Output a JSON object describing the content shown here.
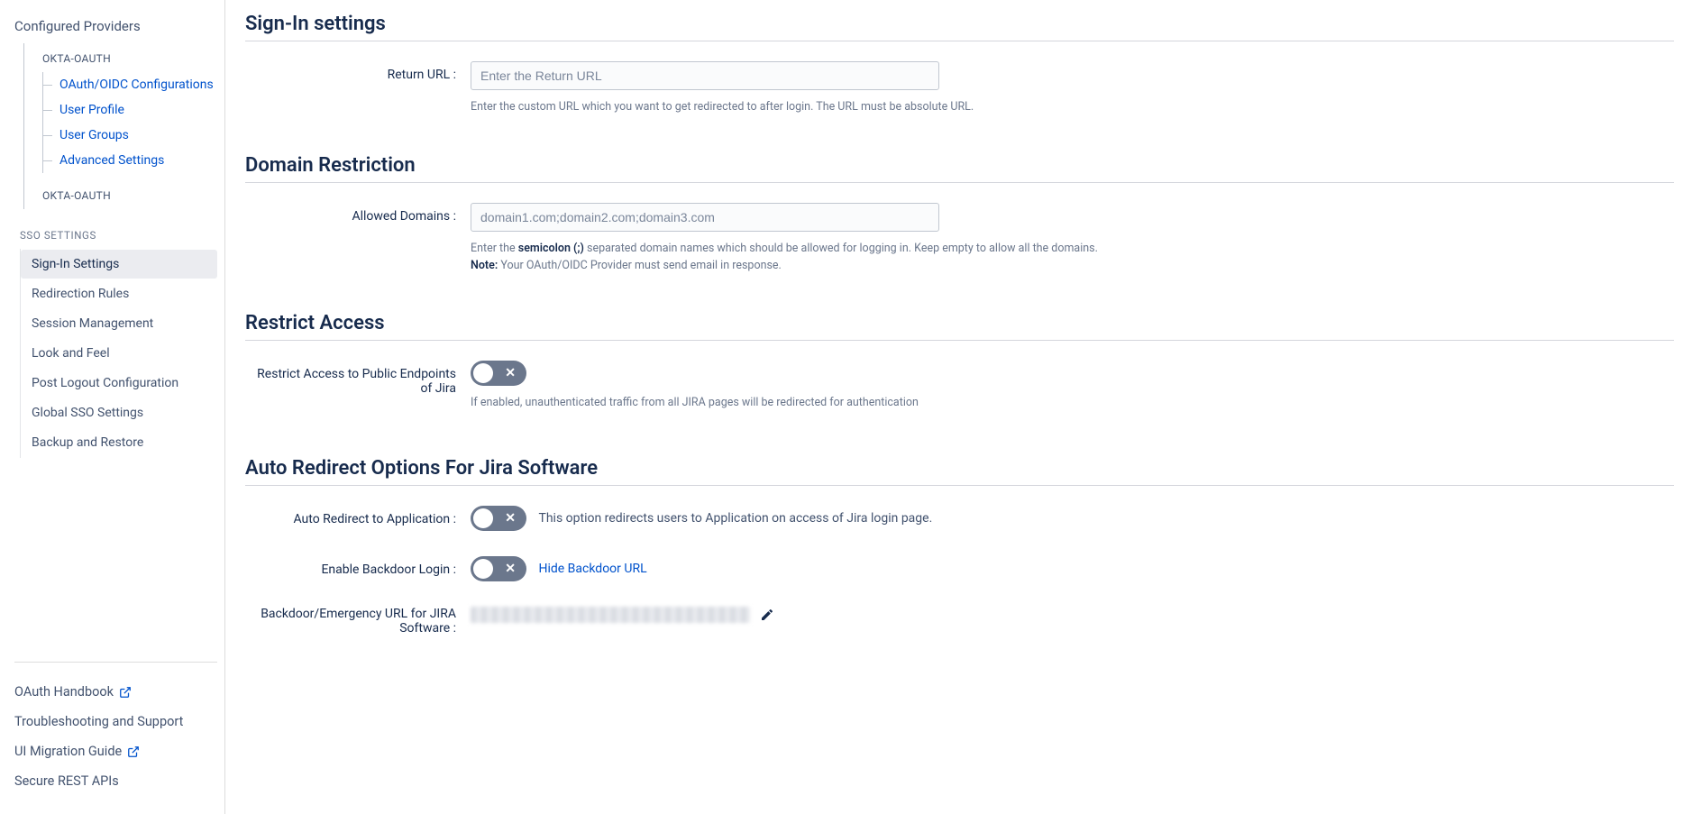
{
  "sidebar": {
    "configured_providers_title": "Configured Providers",
    "provider_1": {
      "label": "OKTA-OAUTH",
      "items": [
        {
          "label": "OAuth/OIDC Configurations"
        },
        {
          "label": "User Profile"
        },
        {
          "label": "User Groups"
        },
        {
          "label": "Advanced Settings"
        }
      ]
    },
    "provider_2": {
      "label": "OKTA-OAUTH"
    },
    "sso_settings_header": "SSO SETTINGS",
    "sso_items": [
      {
        "label": "Sign-In Settings"
      },
      {
        "label": "Redirection Rules"
      },
      {
        "label": "Session Management"
      },
      {
        "label": "Look and Feel"
      },
      {
        "label": "Post Logout Configuration"
      },
      {
        "label": "Global SSO Settings"
      },
      {
        "label": "Backup and Restore"
      }
    ],
    "bottom_items": [
      {
        "label": "OAuth Handbook",
        "external": true
      },
      {
        "label": "Troubleshooting and Support",
        "external": false
      },
      {
        "label": "UI Migration Guide",
        "external": true
      },
      {
        "label": "Secure REST APIs",
        "external": false
      }
    ]
  },
  "main": {
    "signin_heading": "Sign-In settings",
    "return_url": {
      "label": "Return URL :",
      "placeholder": "Enter the Return URL",
      "help": "Enter the custom URL which you want to get redirected to after login. The URL must be absolute URL."
    },
    "domain_restriction_heading": "Domain Restriction",
    "allowed_domains": {
      "label": "Allowed Domains :",
      "placeholder": "domain1.com;domain2.com;domain3.com",
      "help_prefix": "Enter the ",
      "help_strong": "semicolon (;)",
      "help_suffix": " separated domain names which should be allowed for logging in. Keep empty to allow all the domains.",
      "note_label": "Note:",
      "note_text": " Your OAuth/OIDC Provider must send email in response."
    },
    "restrict_access_heading": "Restrict Access",
    "restrict_public": {
      "label": "Restrict Access to Public Endpoints of Jira",
      "help": "If enabled, unauthenticated traffic from all JIRA pages will be redirected for authentication"
    },
    "auto_redirect_heading": "Auto Redirect Options For Jira Software",
    "auto_redirect_app": {
      "label": "Auto Redirect to Application :",
      "description": "This option redirects users to Application on access of Jira login page."
    },
    "enable_backdoor": {
      "label": "Enable Backdoor Login :",
      "link_text": "Hide Backdoor URL"
    },
    "backdoor_url": {
      "label": "Backdoor/Emergency URL for JIRA Software :"
    }
  }
}
